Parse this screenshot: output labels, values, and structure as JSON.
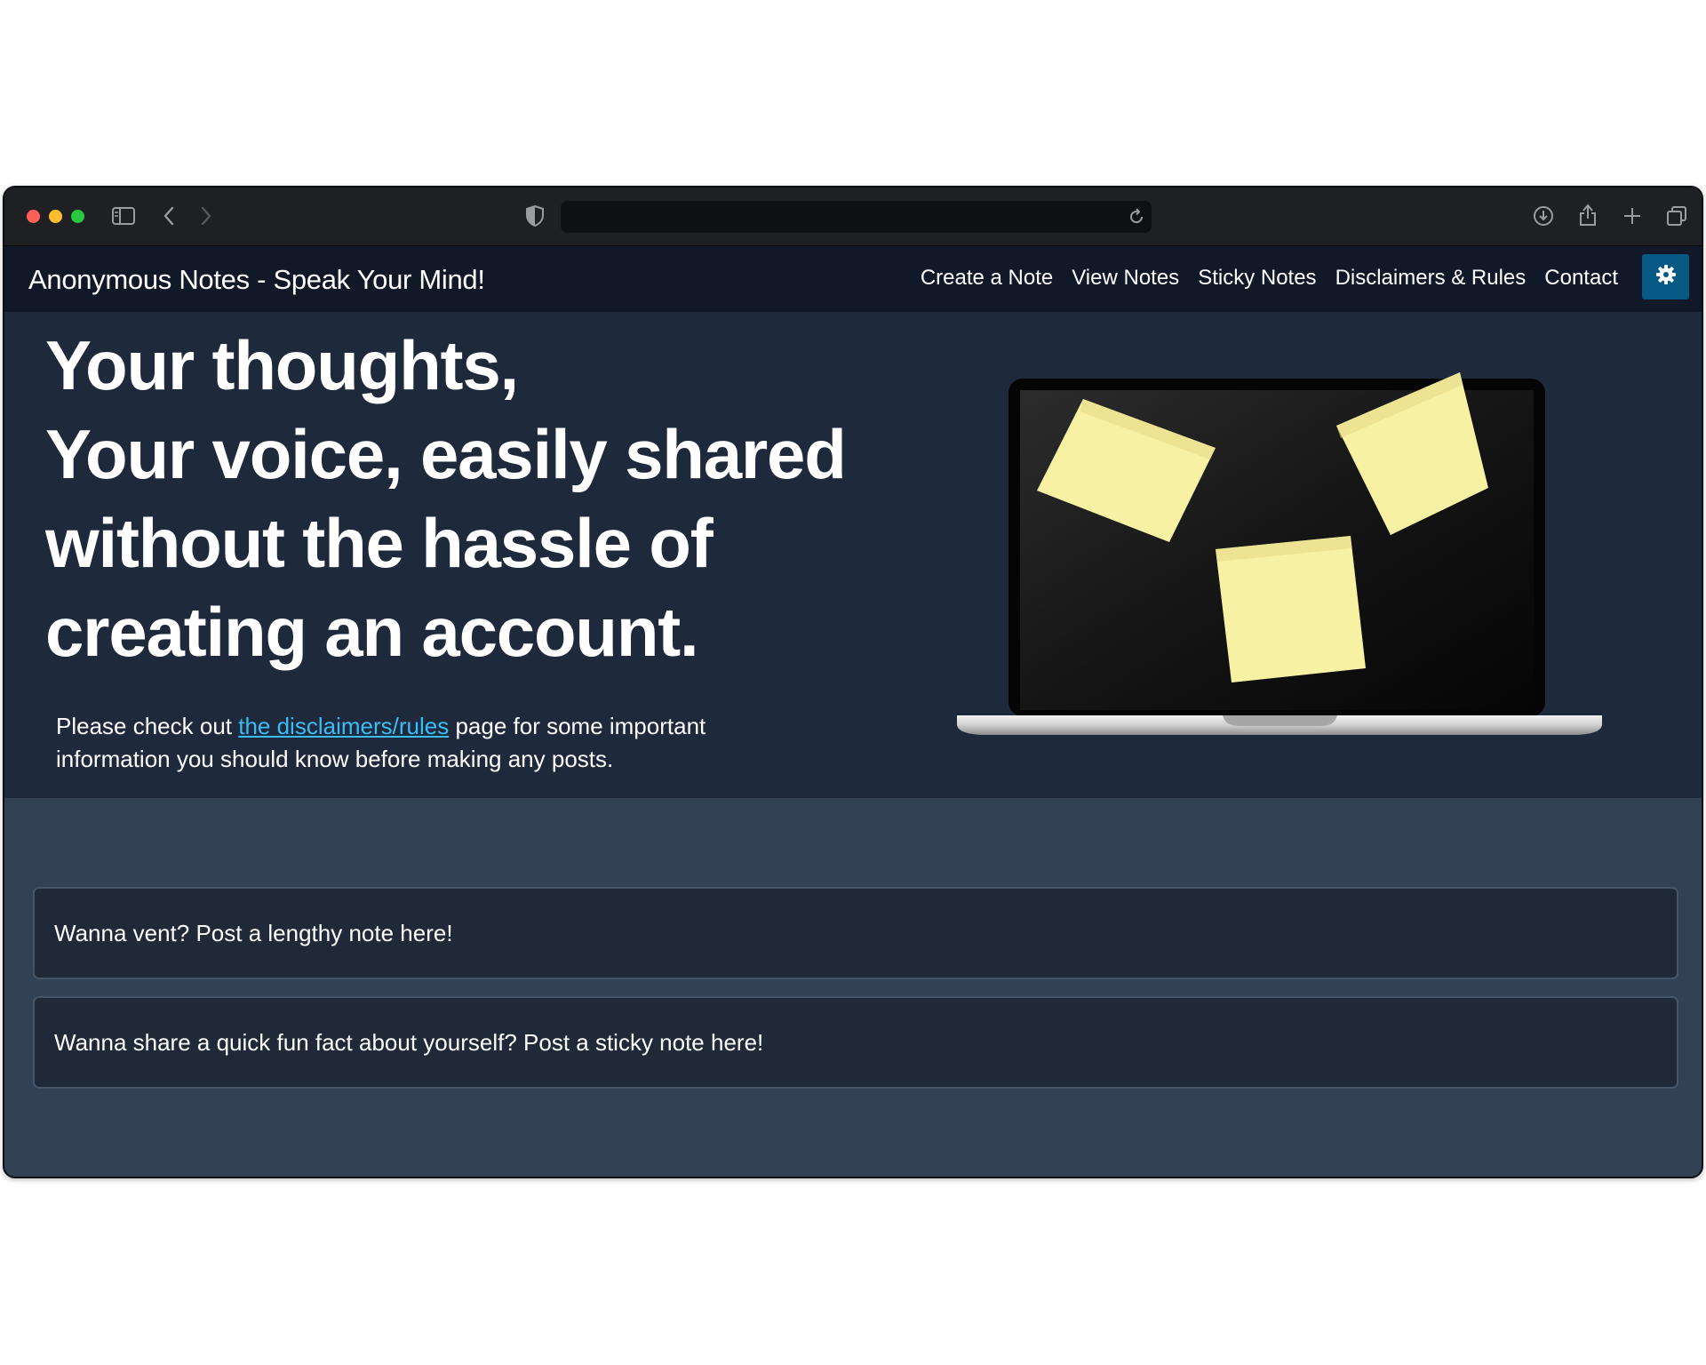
{
  "browser": {
    "traffic_lights": [
      "close",
      "minimize",
      "zoom"
    ],
    "icons": [
      "sidebar-icon",
      "back-icon",
      "forward-icon",
      "shield-icon",
      "reload-icon",
      "download-icon",
      "share-icon",
      "new-tab-icon",
      "tabs-overview-icon"
    ],
    "url": ""
  },
  "nav": {
    "brand": "Anonymous Notes - Speak Your Mind!",
    "links": [
      "Create a Note",
      "View Notes",
      "Sticky Notes",
      "Disclaimers & Rules",
      "Contact"
    ],
    "theme_toggle_icon": "gear-icon"
  },
  "hero": {
    "headline": [
      "Your thoughts,",
      "Your voice, easily shared",
      "without the hassle of",
      "creating an account."
    ],
    "notice_before": "Please check out ",
    "notice_link": "the disclaimers/rules",
    "notice_after": " page for some important information you should know before making any posts.",
    "image": "laptop-with-sticky-notes"
  },
  "cards": [
    "Wanna vent? Post a lengthy note here!",
    "Wanna share a quick fun fact about yourself? Post a sticky note here!"
  ],
  "colors": {
    "navbar": "#111827",
    "hero": "#1e293b",
    "page": "#334155",
    "card": "#1f2937",
    "link": "#38bdf8",
    "theme_button": "#075985",
    "sticky_note": "#f7f1a3"
  }
}
